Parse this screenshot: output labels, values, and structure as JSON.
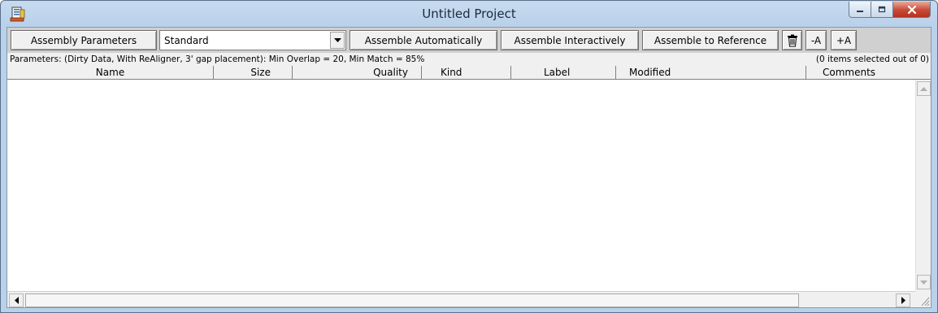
{
  "window": {
    "title": "Untitled Project",
    "icon": "app-document-icon",
    "caption_buttons": [
      "minimize-icon",
      "maximize-icon",
      "close-icon"
    ]
  },
  "toolbar": {
    "assembly_parameters_label": "Assembly Parameters",
    "preset_value": "Standard",
    "assemble_automatically_label": "Assemble Automatically",
    "assemble_interactively_label": "Assemble Interactively",
    "assemble_to_reference_label": "Assemble to Reference",
    "trash_icon": "trash-icon",
    "minus_a_label": "-A",
    "plus_a_label": "+A"
  },
  "status": {
    "parameters_text": "Parameters: (Dirty Data, With ReAligner, 3' gap placement): Min Overlap = 20, Min Match = 85%",
    "selection_text": "(0 items selected out of 0)"
  },
  "columns": [
    {
      "label": "Name"
    },
    {
      "label": "Size"
    },
    {
      "label": "Quality"
    },
    {
      "label": "Kind"
    },
    {
      "label": "Label"
    },
    {
      "label": "Modified"
    },
    {
      "label": "Comments"
    }
  ],
  "rows": []
}
